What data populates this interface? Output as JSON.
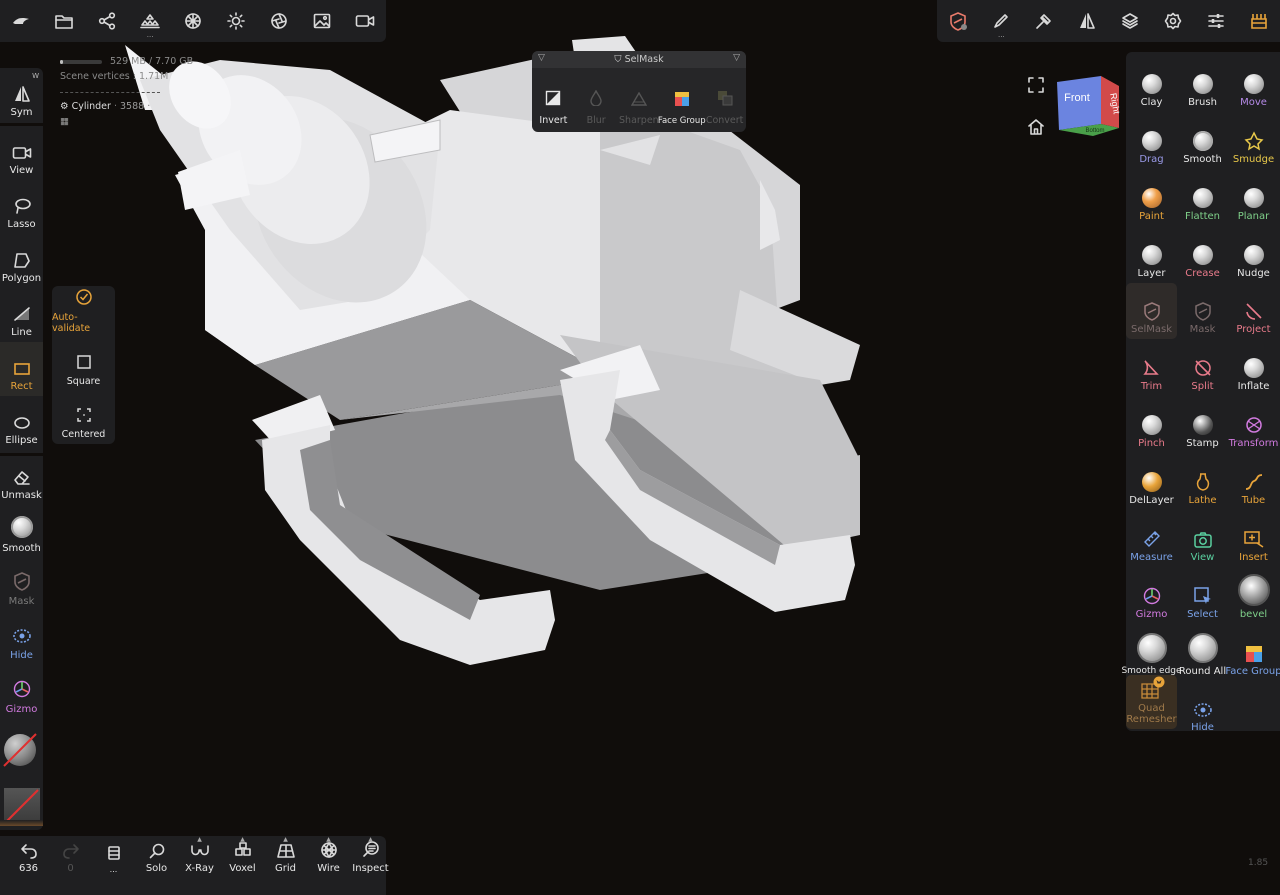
{
  "top_left_toolbar": {
    "items": [
      "logo-icon",
      "folder-icon",
      "share-icon",
      "scene-icon",
      "grid-sphere-icon",
      "sun-icon",
      "aperture-icon",
      "image-icon",
      "camera-icon"
    ]
  },
  "top_right_toolbar": {
    "items": [
      "selmask-icon",
      "brush-settings-icon",
      "stroke-icon",
      "symmetry-icon",
      "layers-icon",
      "gear-icon",
      "sliders-icon",
      "toolbox-icon"
    ]
  },
  "scene_info": {
    "memory": "529 MB / 7.70 GB",
    "memory_fraction": 0.07,
    "vertices_label": "Scene vertices :",
    "vertices_value": "1.71M",
    "object_name": "Cylinder",
    "object_count": "3588"
  },
  "left_tools": {
    "sym": {
      "label": "Sym",
      "badge": "W"
    },
    "view": "View",
    "lasso": "Lasso",
    "polygon": "Polygon",
    "line": "Line",
    "rect": "Rect",
    "ellipse": "Ellipse",
    "unmask": "Unmask",
    "smooth": "Smooth",
    "mask": "Mask",
    "hide": "Hide",
    "gizmo": "Gizmo"
  },
  "rect_options": {
    "auto_validate": "Auto-validate",
    "square": "Square",
    "centered": "Centered"
  },
  "selmask_popup": {
    "title": "SelMask",
    "items": [
      {
        "label": "Invert",
        "enabled": true
      },
      {
        "label": "Blur",
        "enabled": false
      },
      {
        "label": "Sharpen",
        "enabled": false
      },
      {
        "label": "Face Group",
        "enabled": true
      },
      {
        "label": "Convert",
        "enabled": false
      }
    ]
  },
  "view_cube": {
    "front": "Front",
    "right": "Right",
    "bottom": "Bottom"
  },
  "tools": {
    "clay": "Clay",
    "brush": "Brush",
    "move": "Move",
    "drag": "Drag",
    "smooth": "Smooth",
    "smudge": "Smudge",
    "paint": "Paint",
    "flatten": "Flatten",
    "planar": "Planar",
    "layer": "Layer",
    "crease": "Crease",
    "nudge": "Nudge",
    "selmask": "SelMask",
    "mask": "Mask",
    "project": "Project",
    "trim": "Trim",
    "split": "Split",
    "inflate": "Inflate",
    "pinch": "Pinch",
    "stamp": "Stamp",
    "transform": "Transform",
    "dellayer": "DelLayer",
    "lathe": "Lathe",
    "tube": "Tube",
    "measure": "Measure",
    "view": "View",
    "insert": "Insert",
    "gizmo": "Gizmo",
    "select": "Select",
    "bevel": "bevel",
    "smooth_edge": "Smooth edge",
    "round_all": "Round All",
    "face_group": "Face Group",
    "quad_remesher_1": "Quad",
    "quad_remesher_2": "Remesher",
    "hide": "Hide"
  },
  "bottom_bar": {
    "undo_count": "636",
    "redo_count": "0",
    "history_dots": "...",
    "solo": "Solo",
    "xray": "X-Ray",
    "voxel": "Voxel",
    "grid": "Grid",
    "wire": "Wire",
    "inspect": "Inspect"
  },
  "version": "1.85",
  "colors": {
    "accent_orange": "#e8a43a",
    "blue_label": "#7aa2e8",
    "green_label": "#7fd08a",
    "pink_label": "#e97b8b",
    "purple_label": "#d27be0",
    "panel_bg": "#1f1f21",
    "viewport_bg": "#100d0b"
  }
}
